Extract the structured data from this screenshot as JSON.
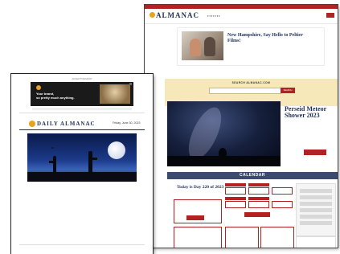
{
  "website": {
    "brand": "ALMANAC",
    "promo": {
      "title": "New Hampshire, Say Hello to Peltier Films!"
    },
    "search": {
      "label": "SEARCH ALMANAC.COM",
      "button": "SEARCH"
    },
    "feature": {
      "title": "Perseid Meteor Shower 2023"
    },
    "calendar": {
      "header": "CALENDAR",
      "day_text": "Today is Day 220 of 2023"
    }
  },
  "email": {
    "ad_label": "ADVERTISEMENT",
    "ad": {
      "line1": "Your brand,",
      "line2": "so pretty much anything."
    },
    "title": "DAILY ALMANAC",
    "date": "Friday, June 30, 2023"
  },
  "colors": {
    "brand_red": "#b22222",
    "navy": "#1e2f55",
    "sun_gold": "#e8a21b",
    "search_band": "#f6e8b8"
  }
}
